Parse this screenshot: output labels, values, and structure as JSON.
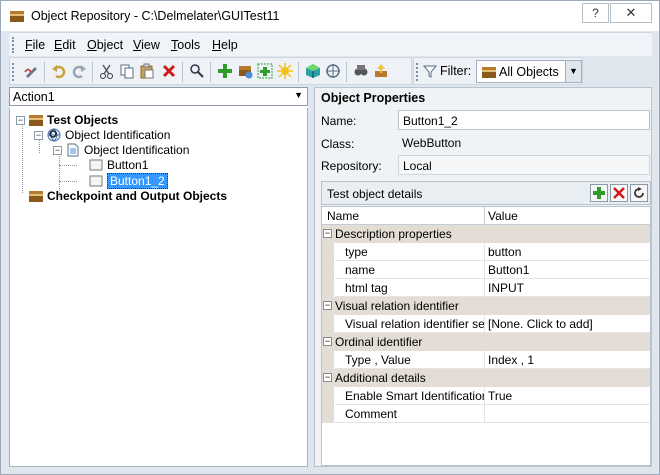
{
  "window": {
    "title": "Object Repository - C:\\Delmelater\\GUITest11",
    "help_glyph": "?",
    "close_glyph": "✕"
  },
  "menu": [
    {
      "id": "file",
      "underline": "F",
      "rest": "ile"
    },
    {
      "id": "edit",
      "underline": "E",
      "rest": "dit"
    },
    {
      "id": "object",
      "underline": "O",
      "rest": "bject"
    },
    {
      "id": "view",
      "underline": "V",
      "rest": "iew"
    },
    {
      "id": "tools",
      "underline": "T",
      "rest": "ools"
    },
    {
      "id": "help",
      "underline": "H",
      "rest": "elp"
    }
  ],
  "filter": {
    "label": "Filter:",
    "selected": "All Objects"
  },
  "action_select": {
    "value": "Action1"
  },
  "tree": {
    "root1": "Test Objects",
    "node1": "Object Identification",
    "node2": "Object Identification",
    "leaf1": "Button1",
    "leaf2": "Button1_2",
    "root2": "Checkpoint and Output Objects"
  },
  "properties": {
    "heading": "Object Properties",
    "name_label": "Name:",
    "name_value": "Button1_2",
    "class_label": "Class:",
    "class_value": "WebButton",
    "repository_label": "Repository:",
    "repository_value": "Local",
    "details_label": "Test object details"
  },
  "grid": {
    "col_name": "Name",
    "col_value": "Value",
    "cat_description": "Description properties",
    "type_name": "type",
    "type_value": "button",
    "name_name": "name",
    "name_value": "Button1",
    "htmltag_name": "html tag",
    "htmltag_value": "INPUT",
    "cat_visual": "Visual relation identifier",
    "visual_name": "Visual relation identifier setti...",
    "visual_value": "[None. Click to add]",
    "cat_ordinal": "Ordinal identifier",
    "ordinal_name": "Type , Value",
    "ordinal_value": "Index , 1",
    "cat_additional": "Additional details",
    "smart_name": "Enable Smart Identification",
    "smart_value": "True",
    "comment_name": "Comment",
    "comment_value": ""
  },
  "colors": {
    "selection": "#3399ff",
    "add_green": "#2e9d2e",
    "remove_red": "#d01a1a"
  }
}
